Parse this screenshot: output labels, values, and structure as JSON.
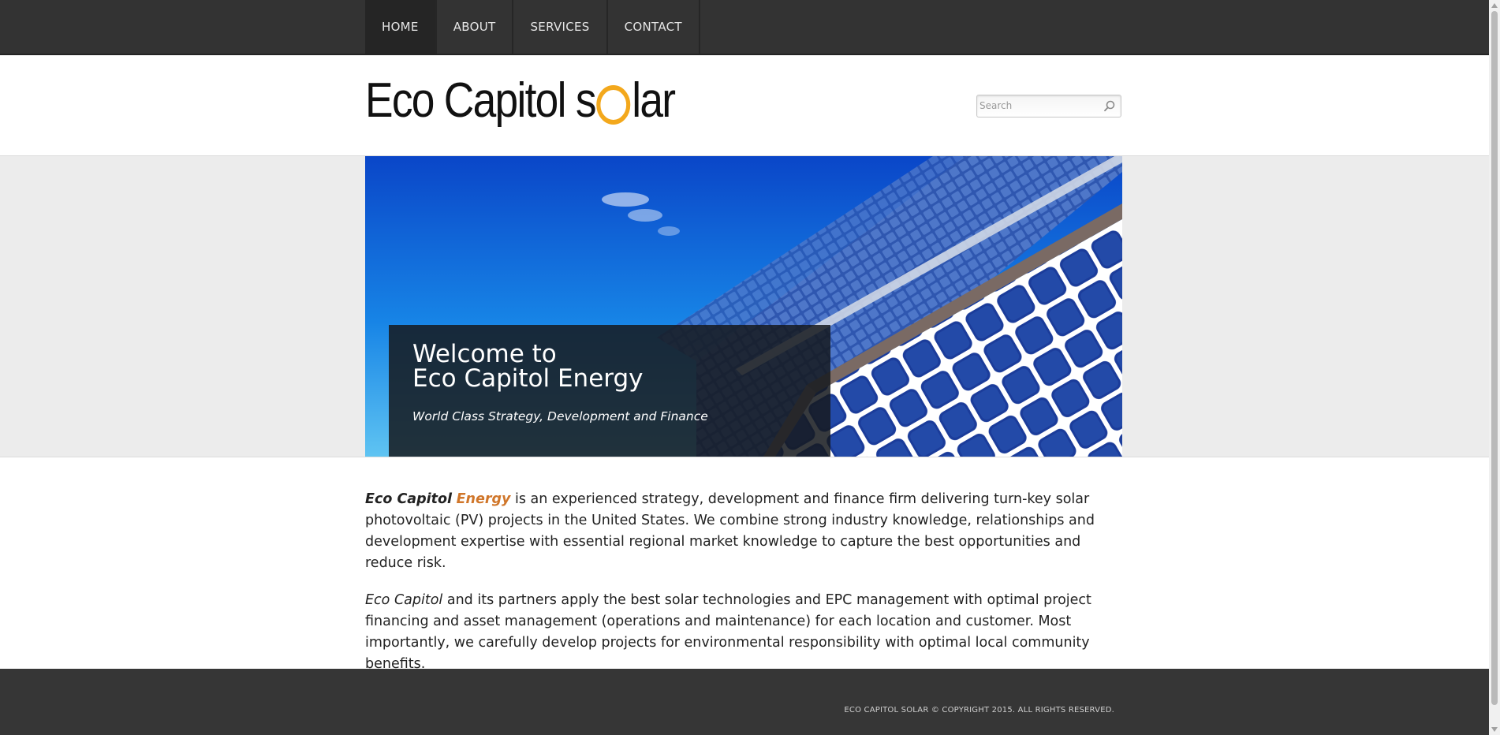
{
  "nav": {
    "items": [
      {
        "label": "HOME",
        "active": true
      },
      {
        "label": "ABOUT",
        "active": false
      },
      {
        "label": "SERVICES",
        "active": false
      },
      {
        "label": "CONTACT",
        "active": false
      }
    ]
  },
  "header": {
    "logo_text_left": "Eco Capitol s",
    "logo_text_right": "lar",
    "logo_ring_color": "#f3a81c",
    "search_placeholder": "Search",
    "search_icon": "search-icon"
  },
  "hero": {
    "image": "solar-panels-photo",
    "title_line1": "Welcome to",
    "title_line2": "Eco Capitol Energy",
    "subtitle": "World Class Strategy, Development and Finance"
  },
  "content": {
    "p1_brand": "Eco Capitol",
    "p1_brand_accent": "Energy",
    "p1_text": " is an experienced strategy, development and finance firm delivering turn-key solar photovoltaic (PV) projects in the United States. We combine strong industry knowledge, relationships and development expertise with essential regional market knowledge to capture the best opportunities and reduce risk.",
    "p2_brand": "Eco Capitol",
    "p2_text": " and its partners apply the best solar technologies and EPC management with optimal project financing and asset management (operations and maintenance) for each location and customer. Most importantly, we carefully develop projects for environmental responsibility with optimal local community benefits.",
    "accent_color": "#d0762a"
  },
  "footer": {
    "copyright": "ECO CAPITOL SOLAR © COPYRIGHT 2015. ALL RIGHTS RESERVED."
  }
}
